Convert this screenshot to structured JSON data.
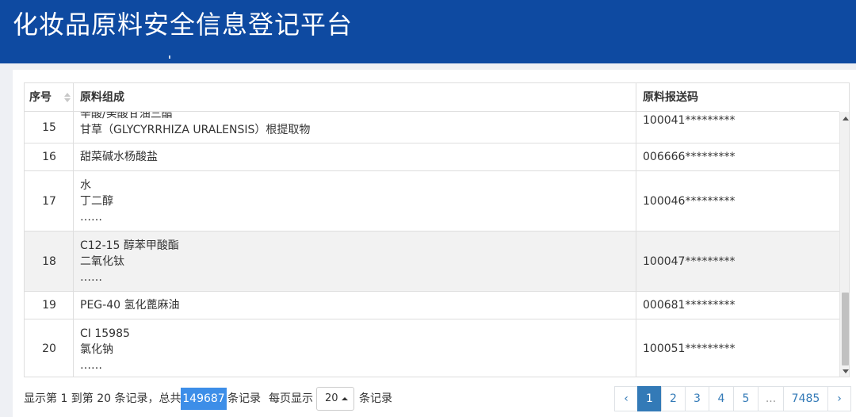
{
  "header": {
    "title": "化妆品原料安全信息登记平台"
  },
  "table": {
    "columns": {
      "index": "序号",
      "ingredients": "原料组成",
      "code": "原料报送码"
    },
    "rows": [
      {
        "index": "15",
        "lines": [
          "辛酸/癸酸甘油三酯",
          "甘草（GLYCYRRHIZA URALENSIS）根提取物"
        ],
        "code": "100041*********"
      },
      {
        "index": "16",
        "lines": [
          "甜菜碱水杨酸盐"
        ],
        "code": "006666*********"
      },
      {
        "index": "17",
        "lines": [
          "水",
          "丁二醇",
          "……"
        ],
        "code": "100046*********"
      },
      {
        "index": "18",
        "lines": [
          "C12-15 醇苯甲酸酯",
          "二氧化钛",
          "……"
        ],
        "code": "100047*********"
      },
      {
        "index": "19",
        "lines": [
          "PEG-40 氢化蓖麻油"
        ],
        "code": "000681*********"
      },
      {
        "index": "20",
        "lines": [
          "CI 15985",
          "氯化钠",
          "……"
        ],
        "code": "100051*********"
      }
    ]
  },
  "footer": {
    "summary_prefix": "显示第 1 到第 20 条记录，总共",
    "total": "149687",
    "summary_suffix": "条记录",
    "per_page_label": "每页显示",
    "page_size": "20",
    "page_size_suffix": "条记录"
  },
  "pagination": {
    "prev": "‹",
    "pages": [
      "1",
      "2",
      "3",
      "4",
      "5"
    ],
    "active": "1",
    "ellipsis": "...",
    "last": "7485",
    "next": "›"
  },
  "colors": {
    "header_bg": "#0e4aa1",
    "accent": "#337ab7",
    "total_badge": "#3d8ee8"
  }
}
